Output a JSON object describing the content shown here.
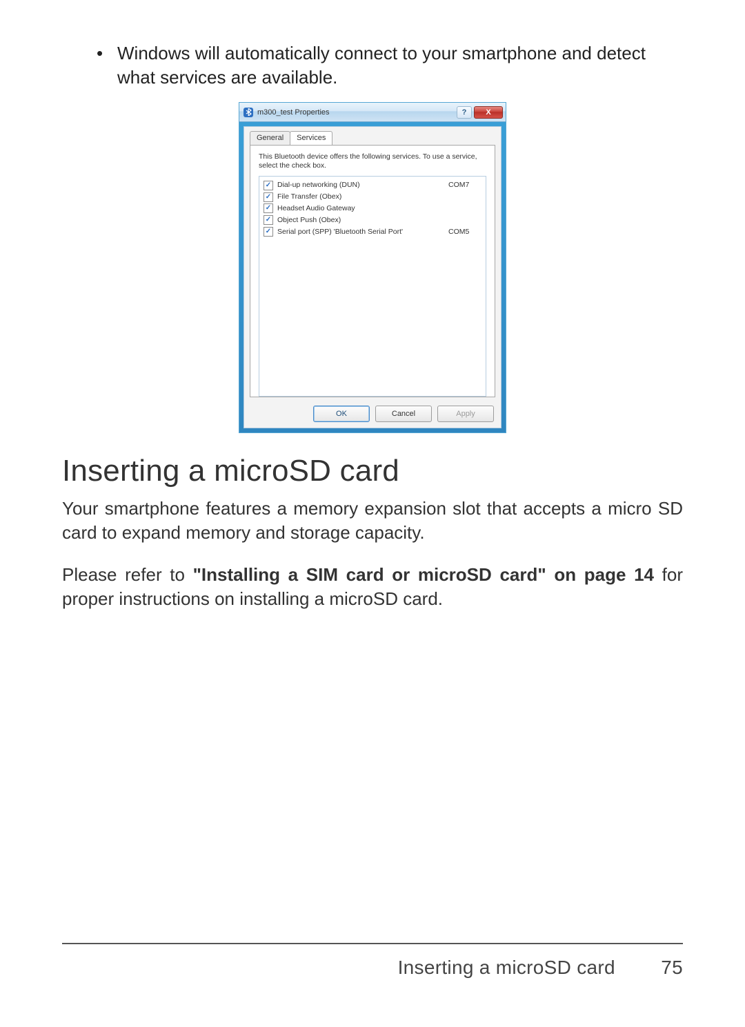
{
  "bullet": {
    "text": "Windows will automatically connect to your smartphone and detect what services are available."
  },
  "dialog": {
    "title": "m300_test Properties",
    "help_label": "?",
    "close_label": "X",
    "tabs": {
      "general": "General",
      "services": "Services"
    },
    "blurb": "This Bluetooth device offers the following services. To use a service, select the check box.",
    "services": [
      {
        "checked": true,
        "label": "Dial-up networking (DUN)",
        "port": "COM7"
      },
      {
        "checked": true,
        "label": "File Transfer (Obex)",
        "port": ""
      },
      {
        "checked": true,
        "label": "Headset Audio Gateway",
        "port": ""
      },
      {
        "checked": true,
        "label": "Object Push (Obex)",
        "port": ""
      },
      {
        "checked": true,
        "label": "Serial port (SPP) 'Bluetooth Serial Port'",
        "port": "COM5"
      }
    ],
    "buttons": {
      "ok": "OK",
      "cancel": "Cancel",
      "apply": "Apply"
    }
  },
  "section": {
    "heading": "Inserting a microSD card",
    "para1": "Your smartphone features a memory expansion slot that accepts a micro SD card to expand memory and storage capacity.",
    "para2_prefix": "Please refer to ",
    "para2_strong": "\"Installing a SIM card or microSD card\" on page 14",
    "para2_suffix": " for proper instructions on installing a microSD card."
  },
  "footer": {
    "title": "Inserting a microSD card",
    "page": "75"
  }
}
